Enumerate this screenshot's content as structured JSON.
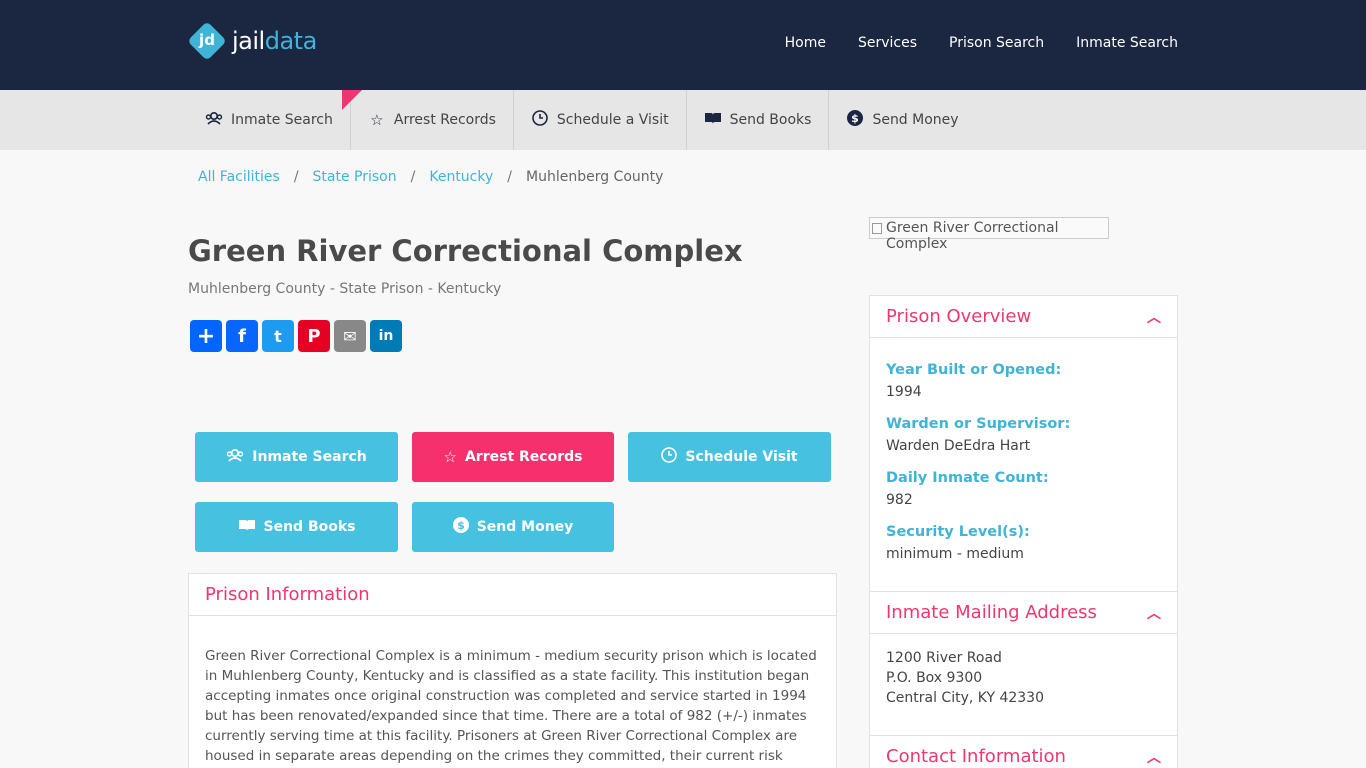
{
  "header": {
    "logo_mark": "jd",
    "logo_jail": "jail",
    "logo_data": "data",
    "nav": [
      "Home",
      "Services",
      "Prison Search",
      "Inmate Search"
    ]
  },
  "subnav": [
    {
      "label": "Inmate Search",
      "icon": "inmate-search-icon"
    },
    {
      "label": "Arrest Records",
      "icon": "star-badge-icon"
    },
    {
      "label": "Schedule a Visit",
      "icon": "clock-icon"
    },
    {
      "label": "Send Books",
      "icon": "book-icon"
    },
    {
      "label": "Send Money",
      "icon": "dollar-icon"
    }
  ],
  "breadcrumb": [
    "All Facilities",
    "State Prison",
    "Kentucky",
    "Muhlenberg County"
  ],
  "facility": {
    "title": "Green River Correctional Complex",
    "subtitle": "Muhlenberg County - State Prison - Kentucky",
    "image_alt": "Green River Correctional Complex"
  },
  "share": [
    "+",
    "f",
    "t",
    "P",
    "✉",
    "in"
  ],
  "actions": {
    "inmate_search": "Inmate Search",
    "arrest_records": "Arrest Records",
    "schedule_visit": "Schedule Visit",
    "send_books": "Send Books",
    "send_money": "Send Money"
  },
  "prison_info": {
    "title": "Prison Information",
    "text": "Green River Correctional Complex is a minimum - medium security prison which is located in Muhlenberg County, Kentucky and is classified as a state facility. This institution began accepting inmates once original construction was completed and service started in 1994 but has been renovated/expanded since that time. There are a total of 982 (+/-) inmates currently serving time at this facility. Prisoners at Green River Correctional Complex are housed in separate areas depending on the crimes they committed, their current risk assessment, and"
  },
  "overview": {
    "title": "Prison Overview",
    "fields": [
      {
        "label": "Year Built or Opened:",
        "value": "1994"
      },
      {
        "label": "Warden or Supervisor:",
        "value": "Warden DeEdra Hart"
      },
      {
        "label": "Daily Inmate Count:",
        "value": "982"
      },
      {
        "label": "Security Level(s):",
        "value": "minimum - medium"
      }
    ]
  },
  "mailing": {
    "title": "Inmate Mailing Address",
    "line1": "1200 River Road",
    "line2": "P.O. Box 9300",
    "line3": "Central City, KY 42330"
  },
  "contact": {
    "title": "Contact Information"
  },
  "colors": {
    "navy": "#1b2640",
    "accent_blue": "#47c1e0",
    "accent_pink": "#f5306d"
  }
}
